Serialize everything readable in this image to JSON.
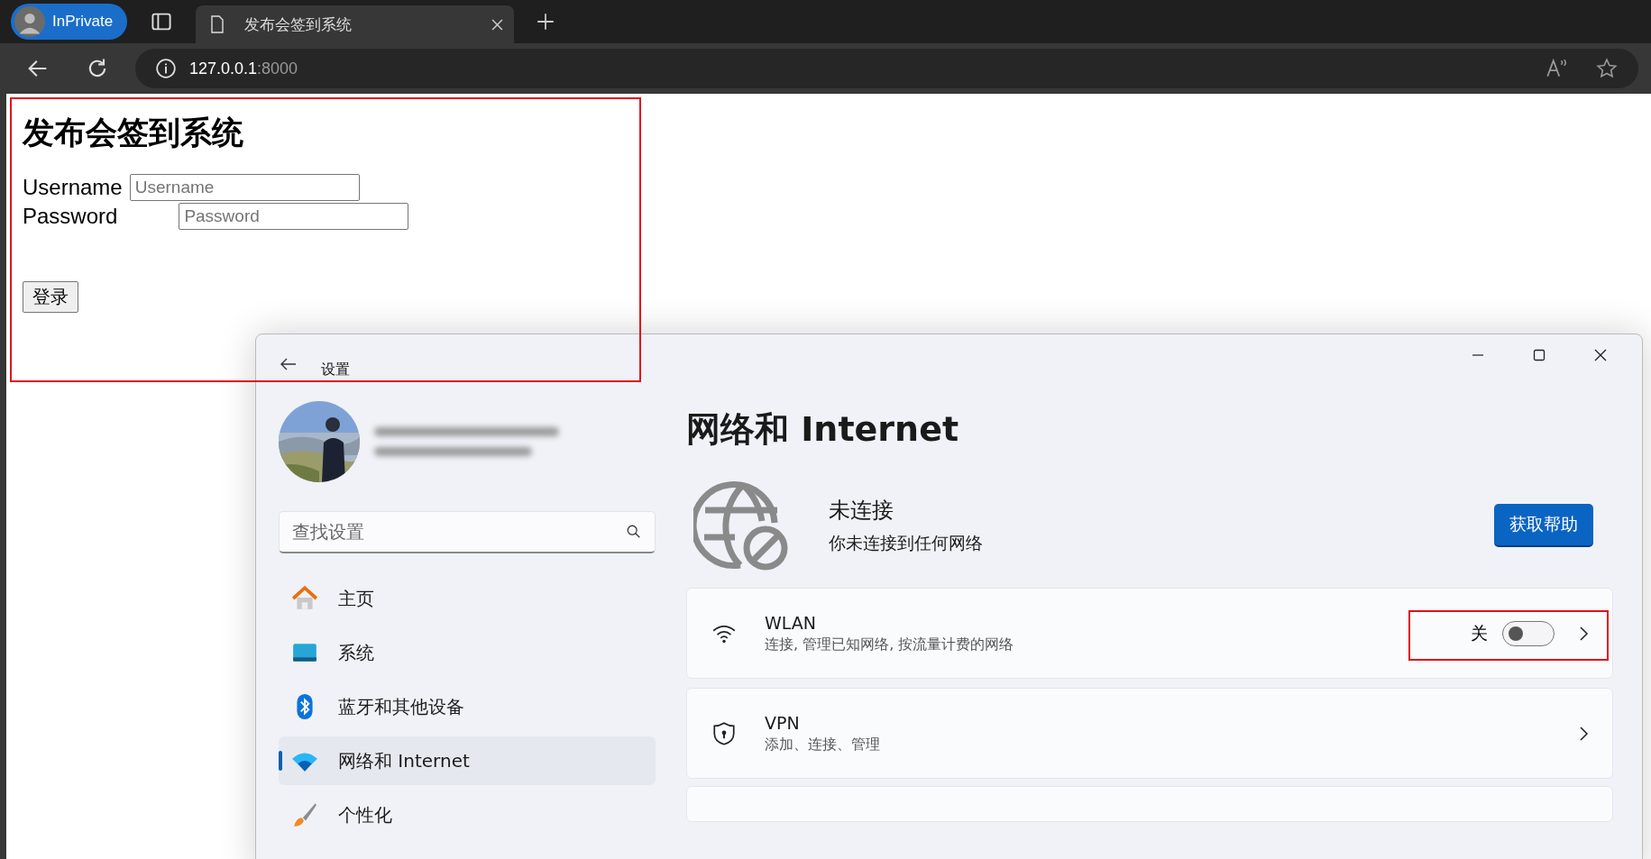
{
  "browser": {
    "profile_badge": "InPrivate",
    "tabs": [
      {
        "title": "发布会签到系统",
        "selected": true
      }
    ],
    "address": {
      "host": "127.0.0.1",
      "port": ":8000"
    }
  },
  "page": {
    "heading": "发布会签到系统",
    "fields": [
      {
        "label": "Username",
        "placeholder": "Username"
      },
      {
        "label": "Password",
        "placeholder": "Password"
      }
    ],
    "submit": "登录"
  },
  "settings_window": {
    "title": "设置",
    "search": {
      "placeholder": "查找设置"
    },
    "nav": [
      {
        "label": "主页",
        "selected": false
      },
      {
        "label": "系统",
        "selected": false
      },
      {
        "label": "蓝牙和其他设备",
        "selected": false
      },
      {
        "label": "网络和 Internet",
        "selected": true
      },
      {
        "label": "个性化",
        "selected": false
      }
    ],
    "heading": "网络和 Internet",
    "status": {
      "title": "未连接",
      "detail": "你未连接到任何网络"
    },
    "help_button": "获取帮助",
    "rows": [
      {
        "kind": "toggle",
        "title": "WLAN",
        "subtitle": "连接, 管理已知网络, 按流量计费的网络",
        "state_label": "关",
        "on": false
      },
      {
        "kind": "link",
        "title": "VPN",
        "subtitle": "添加、连接、管理"
      }
    ]
  }
}
